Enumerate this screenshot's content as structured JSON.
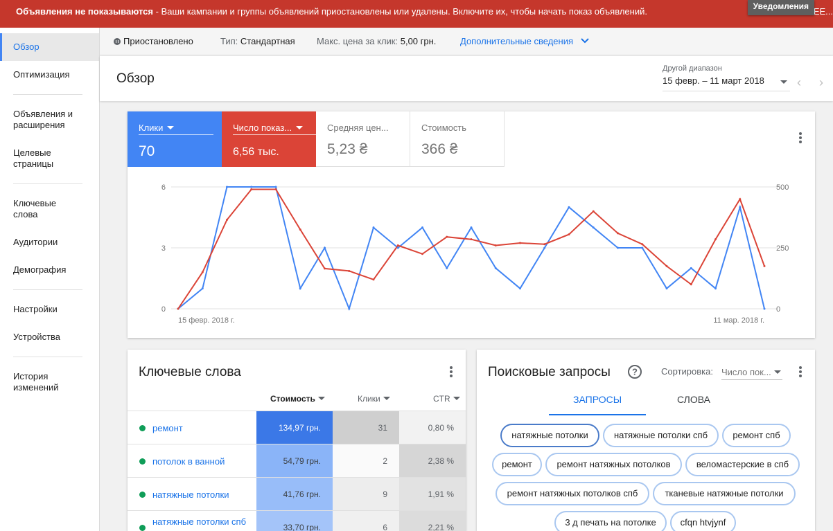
{
  "alert": {
    "bold": "Объявления не показываются",
    "text": " - Ваши кампании и группы объявлений приостановлены или удалены. Включите их, чтобы начать показ объявлений.",
    "tail": "EE..."
  },
  "notifications": "Уведомления",
  "sidebar": {
    "items": [
      "Обзор",
      "Оптимизация",
      "Объявления и расширения",
      "Целевые страницы",
      "Ключевые слова",
      "Аудитории",
      "Демография",
      "Настройки",
      "Устройства",
      "История изменений"
    ]
  },
  "summary": {
    "status": "Приостановлено",
    "type_label": "Тип:",
    "type_value": "Стандартная",
    "max_cpc_label": "Макс. цена за клик:",
    "max_cpc_value": "5,00 грн.",
    "details_link": "Дополнительные сведения"
  },
  "header": {
    "title": "Обзор",
    "range_label": "Другой диапазон",
    "range_value": "15 февр. – 11 март 2018"
  },
  "metrics": [
    {
      "label": "Клики",
      "value": "70",
      "color": "#4285f4"
    },
    {
      "label": "Число показ...",
      "value": "6,56 тыс.",
      "color": "#db4437"
    },
    {
      "label": "Средняя цен...",
      "value": "5,23 ₴"
    },
    {
      "label": "Стоимость",
      "value": "366 ₴"
    }
  ],
  "chart_data": {
    "type": "line",
    "x_start_label": "15 февр. 2018 г.",
    "x_end_label": "11 мар. 2018 г.",
    "left_ticks": [
      "6",
      "3",
      "0"
    ],
    "right_ticks": [
      "500",
      "250",
      "0"
    ],
    "left_range": [
      0,
      6
    ],
    "right_range": [
      0,
      500
    ],
    "grid": true,
    "series": [
      {
        "name": "Клики",
        "axis": "left",
        "color": "#4285f4",
        "values": [
          0,
          1,
          6,
          6,
          6,
          1,
          3,
          0,
          4,
          3,
          4,
          2,
          4,
          2,
          1,
          3,
          5,
          4,
          3,
          3,
          1,
          2,
          1,
          5,
          0
        ]
      },
      {
        "name": "Число показ...",
        "axis": "right",
        "color": "#db4437",
        "values": [
          0,
          150,
          365,
          490,
          490,
          325,
          165,
          155,
          120,
          260,
          225,
          295,
          285,
          260,
          270,
          265,
          305,
          400,
          310,
          265,
          175,
          100,
          285,
          450,
          175
        ]
      }
    ]
  },
  "keywords": {
    "title": "Ключевые слова",
    "col_cost": "Стоимость",
    "col_clicks": "Клики",
    "col_ctr": "CTR",
    "rows": [
      {
        "keyword": "ремонт",
        "cost": "134,97 грн.",
        "clicks": "31",
        "ctr": "0,80 %"
      },
      {
        "keyword": "потолок в ванной",
        "cost": "54,79 грн.",
        "clicks": "2",
        "ctr": "2,38 %"
      },
      {
        "keyword": "натяжные потолки",
        "cost": "41,76 грн.",
        "clicks": "9",
        "ctr": "1,91 %"
      },
      {
        "keyword": "натяжные потолки спб",
        "cost": "33,70 грн.",
        "clicks": "6",
        "ctr": "2,21 %"
      }
    ]
  },
  "queries": {
    "title": "Поисковые запросы",
    "sort_label": "Сортировка:",
    "sort_value": "Число пок...",
    "tabs": [
      "ЗАПРОСЫ",
      "СЛОВА"
    ],
    "chips": [
      "натяжные потолки",
      "натяжные потолки спб",
      "ремонт спб",
      "ремонт",
      "ремонт натяжных потолков",
      "веломастерские в спб",
      "ремонт натяжных потолков спб",
      "тканевые натяжные потолки",
      "3 д печать на потолке",
      "cfqn htvjynf"
    ]
  }
}
